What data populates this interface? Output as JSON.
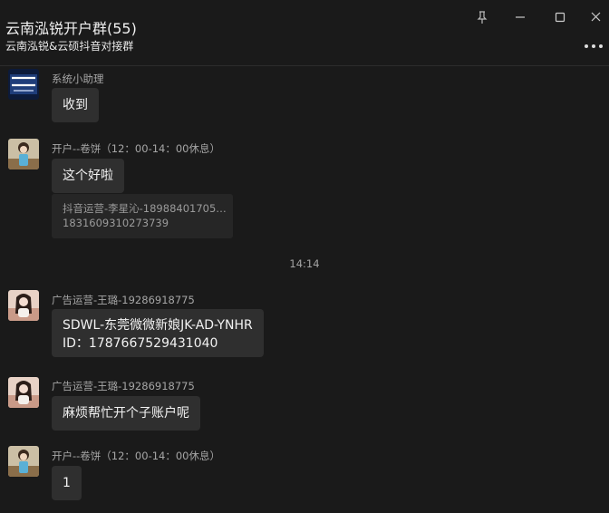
{
  "header": {
    "title": "云南泓锐开户群(55)",
    "subtitle": "云南泓锐&云硕抖音对接群"
  },
  "messages": [
    {
      "sender": "系统小助理",
      "text": "收到",
      "avatar_icon": "system-assistant-avatar"
    },
    {
      "sender": "开户--卷饼（12：00-14：00休息）",
      "text": "这个好啦",
      "avatar_icon": "user-avatar-juanbing",
      "quote_line1": "抖音运营-李星沁-18988401705: ...",
      "quote_line2": "1831609310273739"
    },
    {
      "sender": "广告运营-王璐-19286918775",
      "text_line1": "SDWL-东莞微微新娘JK-AD-YNHR",
      "text_line2": "ID：1787667529431040",
      "avatar_icon": "user-avatar-wanglu"
    },
    {
      "sender": "广告运营-王璐-19286918775",
      "text": "麻烦帮忙开个子账户呢",
      "avatar_icon": "user-avatar-wanglu"
    },
    {
      "sender": "开户--卷饼（12：00-14：00休息）",
      "text": "1",
      "avatar_icon": "user-avatar-juanbing"
    }
  ],
  "timestamp": "14:14",
  "colors": {
    "background": "#1a1a1a",
    "bubble": "#2f2f2f",
    "quote": "#262626",
    "muted_text": "#a6a6a6"
  }
}
